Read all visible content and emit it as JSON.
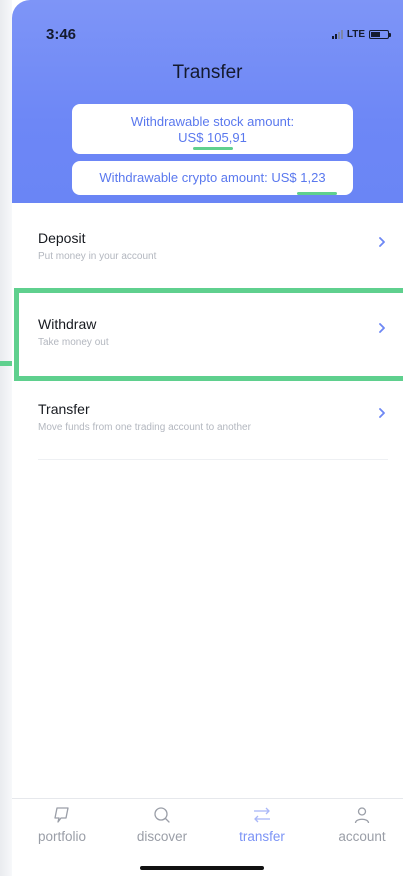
{
  "status_bar": {
    "time": "3:46",
    "network": "LTE"
  },
  "header": {
    "title": "Transfer",
    "stock_card": {
      "label": "Withdrawable stock amount:",
      "amount": "US$ 105,91"
    },
    "crypto_card": {
      "text": "Withdrawable crypto amount: US$ 1,23"
    }
  },
  "menu": {
    "items": [
      {
        "label": "Deposit",
        "sub": "Put money in your account"
      },
      {
        "label": "Withdraw",
        "sub": "Take money out"
      },
      {
        "label": "Transfer",
        "sub": "Move funds from one trading account to another"
      }
    ]
  },
  "tabbar": {
    "items": [
      {
        "label": "portfolio",
        "icon": "portfolio-icon"
      },
      {
        "label": "discover",
        "icon": "search-icon"
      },
      {
        "label": "transfer",
        "icon": "transfer-arrows-icon"
      },
      {
        "label": "account",
        "icon": "person-icon"
      }
    ],
    "active": "transfer"
  },
  "colors": {
    "header_gradient_top": "#7e95f7",
    "header_gradient_bottom": "#6a85f5",
    "accent": "#5a78ee",
    "highlight": "#5fd08e",
    "active_tab": "#7b93f6",
    "inactive_tab": "#9a9ea7"
  }
}
